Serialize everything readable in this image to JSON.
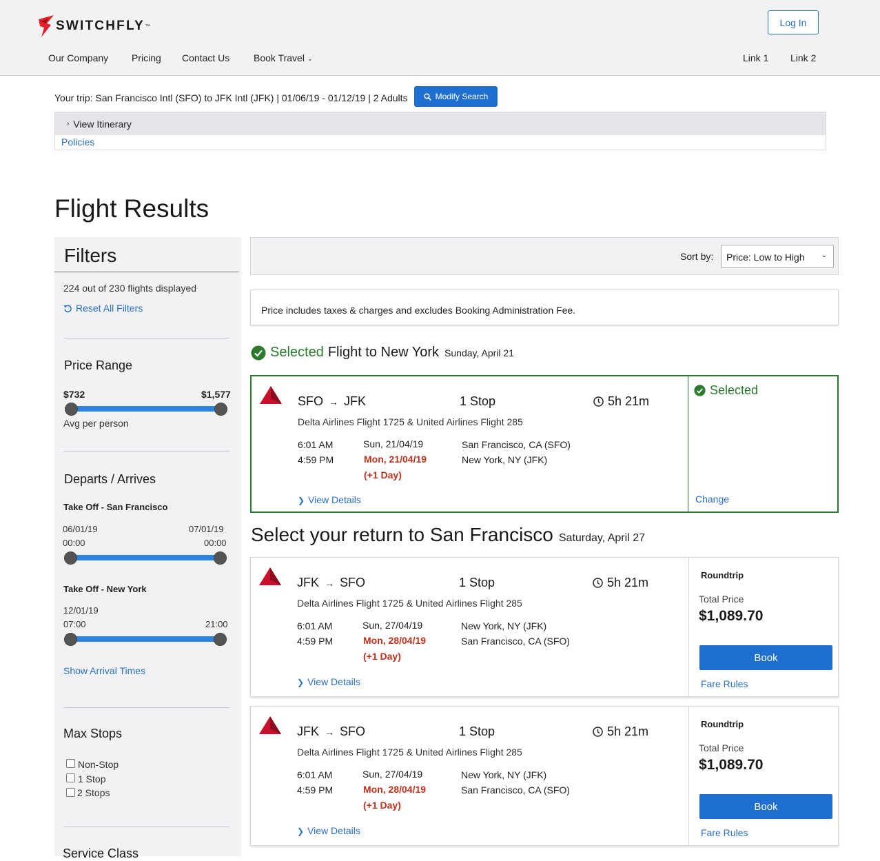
{
  "brand": {
    "name": "SWITCHFLY",
    "tm": "™",
    "accent": "#e0202b"
  },
  "header": {
    "login_label": "Log In",
    "nav_left": [
      "Our Company",
      "Pricing",
      "Contact Us",
      "Book Travel"
    ],
    "nav_right": [
      "Link 1",
      "Link 2"
    ]
  },
  "trip": {
    "summary": "Your trip: San Francisco Intl (SFO) to JFK Intl (JFK) | 01/06/19 - 01/12/19 | 2 Adults",
    "modify_label": "Modify Search",
    "view_itinerary": "View Itinerary",
    "policies": "Policies"
  },
  "page_title": "Flight Results",
  "filters": {
    "title": "Filters",
    "count_text": "224 out of 230 flights displayed",
    "reset_label": "Reset All Filters",
    "price": {
      "heading": "Price Range",
      "min": "$732",
      "max": "$1,577",
      "note": "Avg per person"
    },
    "departs": {
      "heading": "Departs / Arrives",
      "sf_label": "Take Off - San Francisco",
      "sf_date_from": "06/01/19",
      "sf_date_to": "07/01/19",
      "sf_time_from": "00:00",
      "sf_time_to": "00:00",
      "ny_label": "Take Off - New York",
      "ny_date_from": "12/01/19",
      "ny_time_from": "07:00",
      "ny_time_to": "21:00",
      "show_arrival": "Show Arrival Times"
    },
    "stops": {
      "heading": "Max Stops",
      "options": [
        "Non-Stop",
        "1 Stop",
        "2 Stops"
      ]
    },
    "service_class": "Service Class"
  },
  "sort": {
    "label": "Sort by:",
    "value": "Price: Low to High"
  },
  "notice": "Price includes taxes & charges and excludes Booking Administration Fee.",
  "selected_section": {
    "selected_word": "Selected",
    "title": "Flight to New York",
    "date": "Sunday, April 21"
  },
  "return_section": {
    "title": "Select your return to San Francisco",
    "date": "Saturday, April 27"
  },
  "selected_flight": {
    "from": "SFO",
    "to": "JFK",
    "stops": "1 Stop",
    "duration": "5h 21m",
    "carriers": "Delta Airlines Flight 1725 & United Airlines Flight 285",
    "dep_time": "6:01 AM",
    "arr_time": "4:59 PM",
    "dep_date": "Sun, 21/04/19",
    "arr_date": "Mon, 21/04/19",
    "plus_day": "(+1 Day)",
    "dep_city": "San Francisco, CA (SFO)",
    "arr_city": "New York, NY (JFK)",
    "view_details": "View Details",
    "status": "Selected",
    "change": "Change"
  },
  "return_flights": [
    {
      "from": "JFK",
      "to": "SFO",
      "stops": "1 Stop",
      "duration": "5h 21m",
      "carriers": "Delta Airlines Flight 1725 & United Airlines Flight 285",
      "dep_time": "6:01 AM",
      "arr_time": "4:59 PM",
      "dep_date": "Sun, 27/04/19",
      "arr_date": "Mon, 28/04/19",
      "plus_day": "(+1 Day)",
      "dep_city": "New York, NY (JFK)",
      "arr_city": "San Francisco, CA (SFO)",
      "view_details": "View Details",
      "trip_type": "Roundtrip",
      "price_label": "Total Price",
      "price": "$1,089.70",
      "book": "Book",
      "fare_rules": "Fare Rules"
    },
    {
      "from": "JFK",
      "to": "SFO",
      "stops": "1 Stop",
      "duration": "5h 21m",
      "carriers": "Delta Airlines Flight 1725 & United Airlines Flight 285",
      "dep_time": "6:01 AM",
      "arr_time": "4:59 PM",
      "dep_date": "Sun, 27/04/19",
      "arr_date": "Mon, 28/04/19",
      "plus_day": "(+1 Day)",
      "dep_city": "New York, NY (JFK)",
      "arr_city": "San Francisco, CA (SFO)",
      "view_details": "View Details",
      "trip_type": "Roundtrip",
      "price_label": "Total Price",
      "price": "$1,089.70",
      "book": "Book",
      "fare_rules": "Fare Rules"
    }
  ],
  "colors": {
    "primary": "#1f6fd1",
    "link": "#2a6fc4",
    "success": "#2b7a2d",
    "alert": "#c0311e",
    "airline_logo": "#c8102e"
  }
}
